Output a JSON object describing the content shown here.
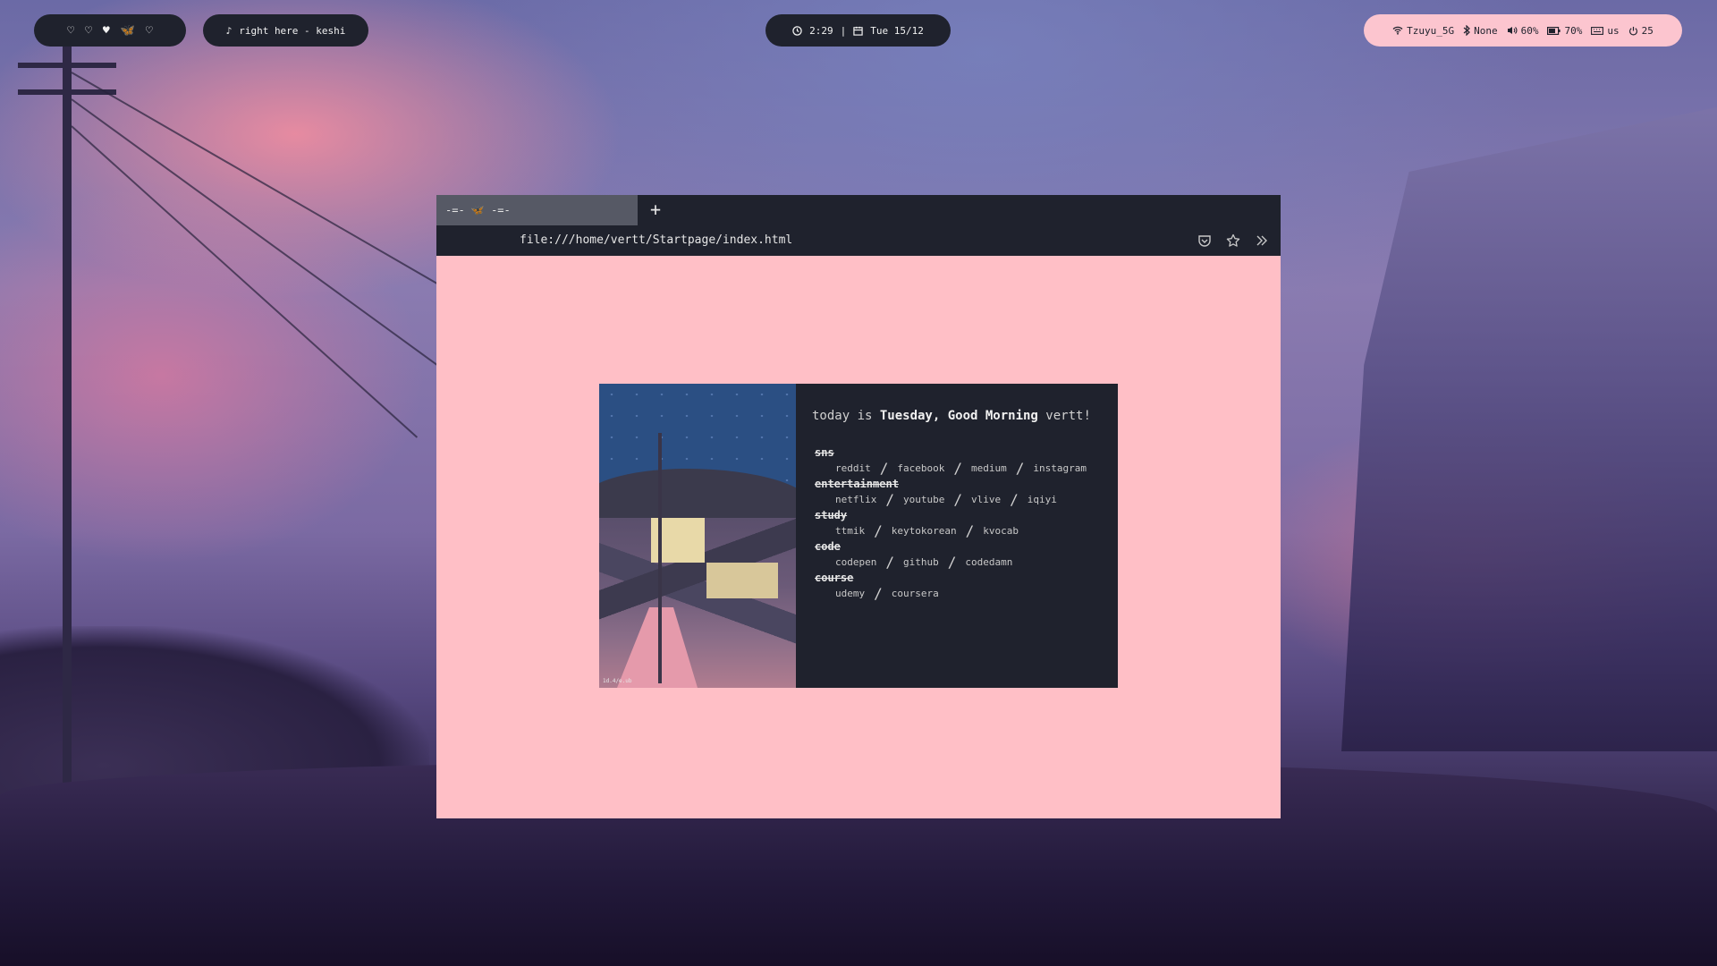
{
  "topbar": {
    "workspaces": [
      "♡",
      "♡",
      "♥",
      "🦋",
      "♡"
    ],
    "media": {
      "icon": "music-note-icon",
      "text": "right here - keshi"
    },
    "clock": {
      "time": "2:29",
      "sep": "|",
      "date": "Tue 15/12"
    },
    "status": {
      "wifi": "Tzuyu_5G",
      "bluetooth": "None",
      "volume": "60%",
      "battery": "70%",
      "keyboard": "us",
      "power": "25"
    }
  },
  "browser": {
    "tab_label": "-=- 🦋 -=-",
    "new_tab": "+",
    "url": "file:///home/vertt/Startpage/index.html"
  },
  "startpage": {
    "greeting_prefix": "today is ",
    "greeting_bold": "Tuesday, Good Morning",
    "greeting_suffix": " vertt!",
    "art_signature": "1d.4/e.ub",
    "groups": [
      {
        "title": "sns",
        "links": [
          "reddit",
          "facebook",
          "medium",
          "instagram"
        ]
      },
      {
        "title": "entertainment",
        "links": [
          "netflix",
          "youtube",
          "vlive",
          "iqiyi"
        ]
      },
      {
        "title": "study",
        "links": [
          "ttmik",
          "keytokorean",
          "kvocab"
        ]
      },
      {
        "title": "code",
        "links": [
          "codepen",
          "github",
          "codedamn"
        ]
      },
      {
        "title": "course",
        "links": [
          "udemy",
          "coursera"
        ]
      }
    ]
  }
}
